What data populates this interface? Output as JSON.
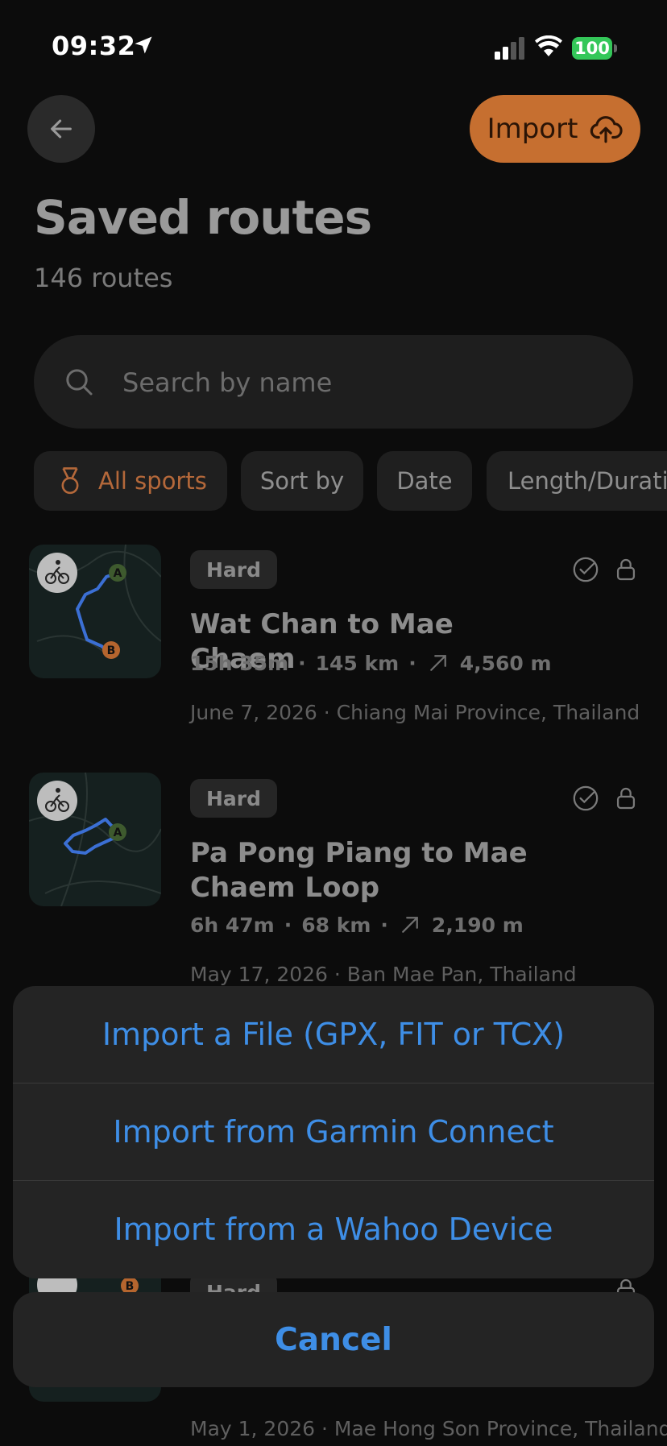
{
  "status_bar": {
    "time": "09:32",
    "battery": "100"
  },
  "header": {
    "import_label": "Import",
    "title": "Saved routes",
    "count": "146 routes"
  },
  "search": {
    "placeholder": "Search by name"
  },
  "filters": {
    "all_sports": "All sports",
    "sort_by": "Sort by",
    "date": "Date",
    "length": "Length/Durati"
  },
  "routes": [
    {
      "badge": "Hard",
      "title": "Wat Chan to Mae Chaem",
      "duration": "15h 35m",
      "distance": "145 km",
      "elevation": "4,560 m",
      "meta": "June 7, 2026 · Chiang Mai Province, Thailand"
    },
    {
      "badge": "Hard",
      "title_line1": "Pa Pong Piang to Mae",
      "title_line2": "Chaem Loop",
      "duration": "6h 47m",
      "distance": "68 km",
      "elevation": "2,190 m",
      "meta": "May 17, 2026 · Ban Mae Pan, Thailand"
    },
    {
      "badge": "Hard",
      "meta": "May 1, 2026 · Mae Hong Son Province, Thailand"
    }
  ],
  "sheet": {
    "options": [
      "Import a File (GPX, FIT or TCX)",
      "Import from Garmin Connect",
      "Import from a Wahoo Device"
    ],
    "cancel": "Cancel"
  },
  "colors": {
    "accent": "#c66f30",
    "link": "#3e8ee6",
    "background": "#0c0c0c",
    "battery": "#34c759"
  }
}
